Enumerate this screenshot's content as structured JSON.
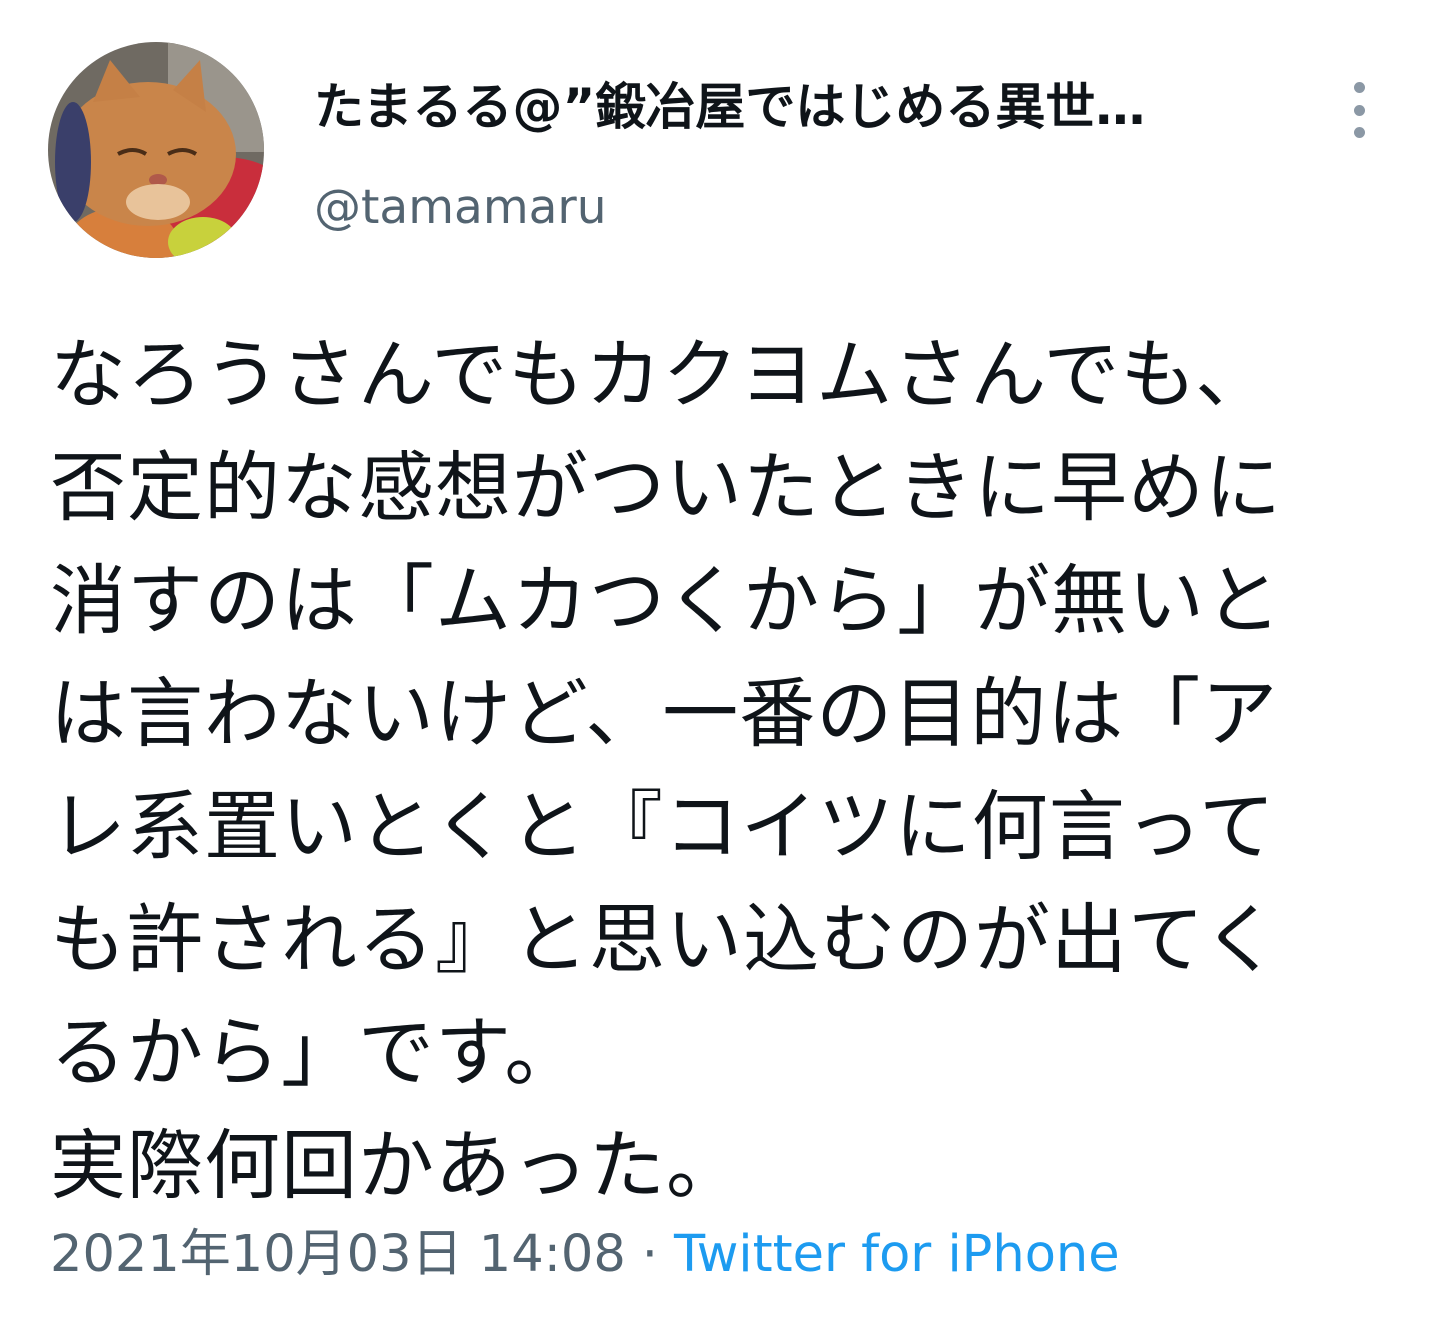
{
  "tweet": {
    "author": {
      "display_name": "たまるる@”鍛冶屋ではじめる異世…",
      "handle": "@tamamaru",
      "avatar_icon": "cat-avatar-icon"
    },
    "menu_icon": "more-vertical-icon",
    "body_lines": [
      "なろうさんでもカクヨムさんでも、",
      "否定的な感想がついたときに早めに",
      "消すのは「ムカつくから」が無いと",
      "は言わないけど、一番の目的は「ア",
      "レ系置いとくと『コイツに何言って",
      "も許される』と思い込むのが出てく",
      "るから」です。",
      "実際何回かあった。"
    ],
    "timestamp": "2021年10月03日 14:08",
    "separator": "·",
    "source": "Twitter for iPhone"
  },
  "colors": {
    "text_primary": "#0f1419",
    "text_secondary": "#536471",
    "link": "#1d9bf0",
    "icon_gray": "#8b98a5"
  }
}
